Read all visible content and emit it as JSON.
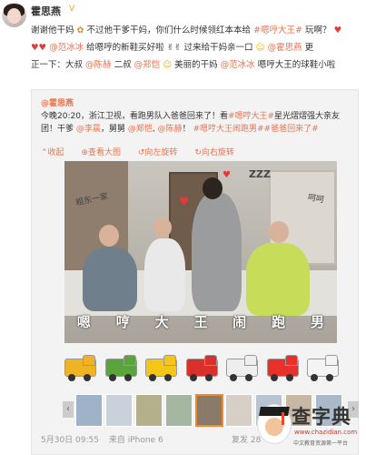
{
  "post": {
    "username": "霍思燕",
    "verified_badge": "V",
    "line1_a": "谢谢他干妈",
    "line1_b": "不过他干爹干妈，你们什么时候领红本本给",
    "line1_tag": "#嗯哼大王#",
    "line1_c": "玩啊？",
    "line2_mention": "@范冰冰",
    "line2_a": "给嗯哼的新鞋买好啦",
    "line2_b": "过来给干妈亲一口",
    "line2_mention2": "@霍思燕",
    "line2_c": "更",
    "line3_a": "正一下：大叔",
    "line3_m1": "@陈赫",
    "line3_b": "二叔",
    "line3_m2": "@郑恺",
    "line3_c": "美丽的干妈",
    "line3_m3": "@范冰冰",
    "line3_d": "嗯哼大王的球鞋小啦"
  },
  "retweet": {
    "author": "@霍思燕",
    "text_a": "今晚20:20，浙江卫视，看跑男队入爸爸回来了！看",
    "tag1": "#嗯哼大王#",
    "text_b": "星光熠熠强大亲友团！干爹",
    "m1": "@李晨",
    "text_c": "，舅舅",
    "m2": "@郑恺",
    "m3": "@陈赫",
    "text_d": "！",
    "tag2": "#嗯哼大王闹跑男##爸爸回来了#",
    "actions": [
      "收起",
      "查看大图",
      "向左旋转",
      "向右旋转"
    ]
  },
  "photo": {
    "doodle_left": "粗东一家",
    "doodle_right": "呵呵",
    "doodle_zzz": "ZZZ",
    "subtitle_chars": [
      "嗯",
      "哼",
      "大",
      "王",
      "闹",
      "跑",
      "男"
    ]
  },
  "vehicles": [
    {
      "name": "truck-icon",
      "color": "#f0b323"
    },
    {
      "name": "lorry-icon",
      "color": "#5aa53b"
    },
    {
      "name": "taxi-icon",
      "color": "#f5c518"
    },
    {
      "name": "fire-engine-icon",
      "color": "#d9302b"
    },
    {
      "name": "ambulance-icon",
      "color": "#eeeeee"
    },
    {
      "name": "red-car-icon",
      "color": "#e8312b"
    },
    {
      "name": "police-car-icon",
      "color": "#f4f4f4"
    }
  ],
  "thumbnails": {
    "count": 9,
    "selected_index": 4,
    "colors": [
      "#9fb3c8",
      "#c9d2db",
      "#b5b08c",
      "#a5b7a0",
      "#8a7a6a",
      "#d5cfc6",
      "#b8c4cf",
      "#c7b8a6",
      "#aab9c9"
    ]
  },
  "footer": {
    "time": "5月30日 09:55",
    "source": "来自 iPhone 6",
    "more": "复发 28"
  },
  "watermark": {
    "title": "查字典",
    "url": "www.chazidian.com",
    "tagline": "中文教育资源第一平台"
  },
  "colors": {
    "link": "#eb7350",
    "heart": "#e23b3b",
    "selected_border": "#f08a2b"
  }
}
